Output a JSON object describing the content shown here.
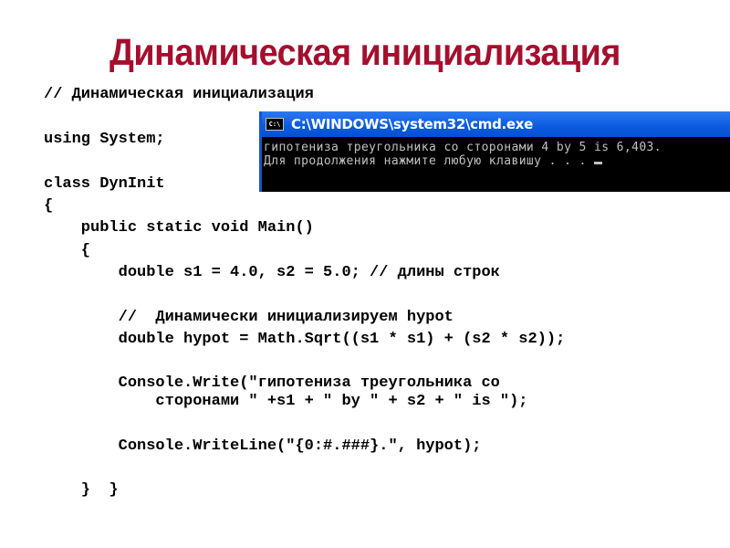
{
  "slide": {
    "title": "Динамическая инициализация"
  },
  "code": {
    "lines": [
      "// Динамическая инициализация",
      "using System;",
      "class DynInit",
      "{",
      "    public static void Main()",
      "    {",
      "        double s1 = 4.0, s2 = 5.0; // длины строк",
      "        //  Динамически инициализируем hypot",
      "        double hypot = Math.Sqrt((s1 * s1) + (s2 * s2));",
      "        Console.Write(\"гипотениза треугольника со",
      "            сторонами \" +s1 + \" by \" + s2 + \" is \");",
      "        Console.WriteLine(\"{0:#.###}.\", hypot);",
      "    }  }"
    ]
  },
  "console_window": {
    "icon": "cmd-icon",
    "icon_text": "C:\\",
    "title": "C:\\WINDOWS\\system32\\cmd.exe",
    "output_lines": [
      "гипотениза треугольника со сторонами 4 by 5 is 6,403.",
      "Для продолжения нажмите любую клавишу . . . "
    ]
  },
  "colors": {
    "title": "#a50f2d",
    "titlebar": "#0a5ae0",
    "console_bg": "#000000",
    "console_text": "#c0c0c0"
  }
}
